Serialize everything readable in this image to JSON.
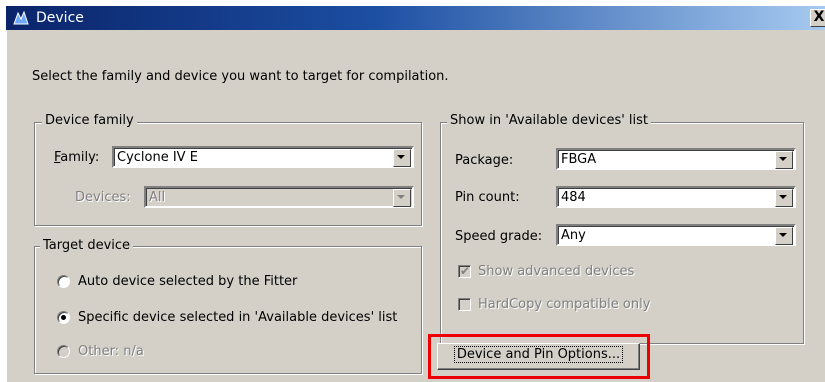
{
  "window": {
    "title": "Device",
    "close_glyph": "X",
    "icon": "altera-quartus-icon"
  },
  "instruction": "Select the family and device you want to target for compilation.",
  "device_family": {
    "group_label": "Device family",
    "family_label": "Family:",
    "family_value": "Cyclone IV E",
    "devices_label": "Devices:",
    "devices_value": "All"
  },
  "target_device": {
    "group_label": "Target device",
    "options": [
      {
        "label": "Auto device selected by the Fitter",
        "selected": false,
        "enabled": true
      },
      {
        "label": "Specific device selected in 'Available devices' list",
        "selected": true,
        "enabled": true
      },
      {
        "label": "Other:  n/a",
        "selected": false,
        "enabled": false
      }
    ]
  },
  "show_list": {
    "group_label": "Show in 'Available devices' list",
    "package_label": "Package:",
    "package_value": "FBGA",
    "pin_count_label": "Pin count:",
    "pin_count_value": "484",
    "speed_grade_label": "Speed grade:",
    "speed_grade_value": "Any",
    "show_advanced_label": "Show advanced devices",
    "show_advanced_checked": true,
    "hardcopy_label": "HardCopy compatible only",
    "hardcopy_checked": false
  },
  "device_pin_button": "Device and Pin Options...",
  "colors": {
    "title_start": "#0a246a",
    "title_end": "#a6caf0",
    "dialog_bg": "#d4d0c8",
    "highlight": "#ee0000"
  }
}
